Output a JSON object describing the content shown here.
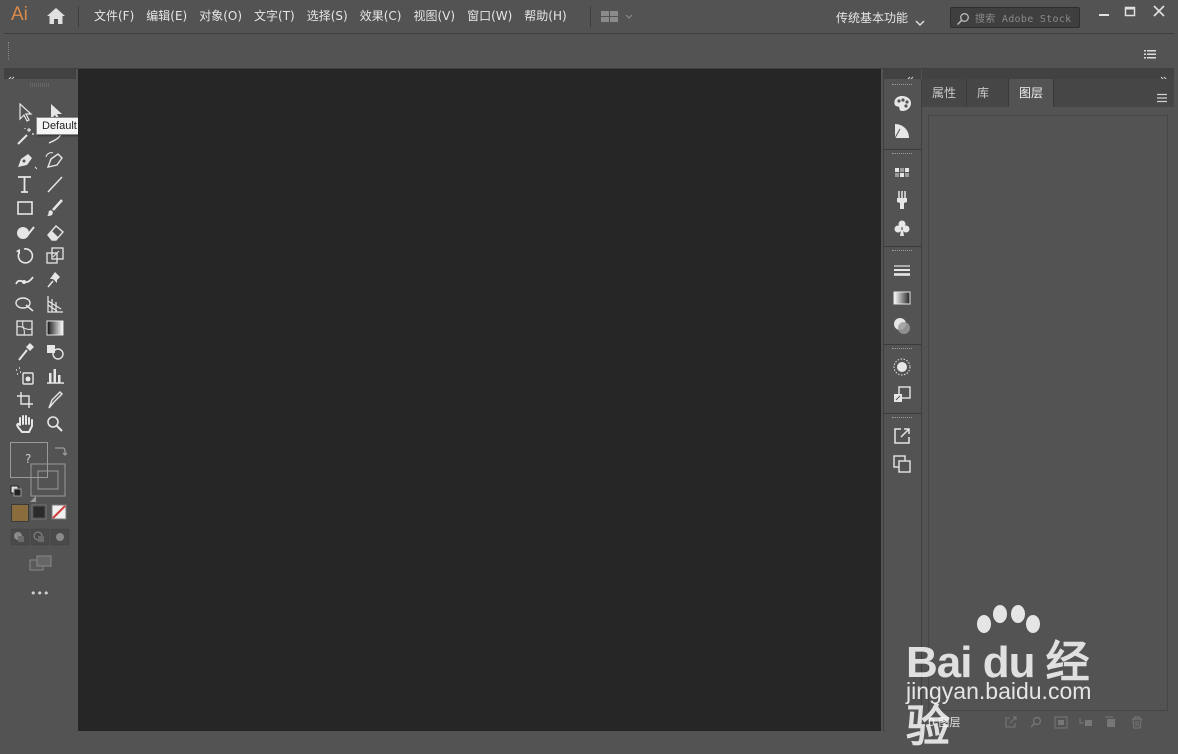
{
  "app": {
    "logo_text": "Ai",
    "menus": [
      "文件(F)",
      "编辑(E)",
      "对象(O)",
      "文字(T)",
      "选择(S)",
      "效果(C)",
      "视图(V)",
      "窗口(W)",
      "帮助(H)"
    ],
    "workspace": "传统基本功能",
    "search_placeholder": "搜索 Adobe Stock"
  },
  "toolbar": {
    "tooltip": "Default",
    "fill_stroke_placeholder": "?",
    "more_label": "•••"
  },
  "panel": {
    "tabs": [
      "属性",
      "库",
      "图层"
    ],
    "active_tab": "图层",
    "layers_count": "0 图层"
  },
  "watermark": {
    "logo": "Bai du 经验",
    "url": "jingyan.baidu.com"
  },
  "colors": {
    "ui_background": "#535353",
    "canvas": "#262626",
    "brand_accent": "#d98a4a"
  }
}
